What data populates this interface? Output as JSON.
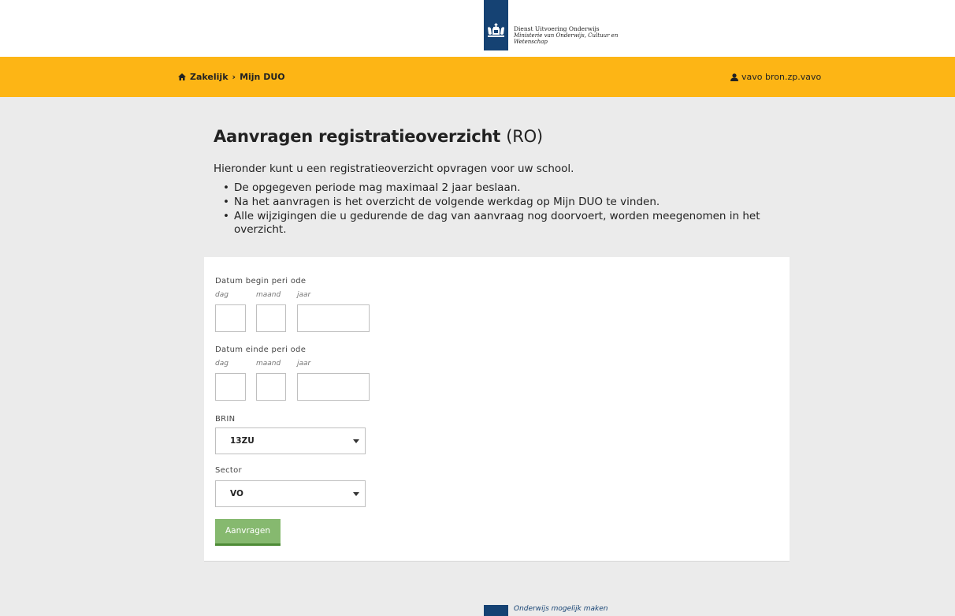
{
  "header": {
    "org_name": "Dienst Uitvoering Onderwijs",
    "ministry_line1": "Ministerie van Onderwijs, Cultuur en",
    "ministry_line2": "Wetenschap",
    "brand_color": "#154273"
  },
  "nav": {
    "home_icon": "home-icon",
    "crumb_1": "Zakelijk",
    "separator": "›",
    "crumb_2": "Mijn DUO",
    "user_icon": "user-icon",
    "user_name": "vavo bron.zp.vavo",
    "bar_color": "#fdb515"
  },
  "page": {
    "title": "Aanvragen registratieoverzicht",
    "title_suffix": "(RO)",
    "intro": "Hieronder kunt u een registratieoverzicht opvragen voor uw school.",
    "bullets": [
      "De opgegeven periode mag maximaal 2 jaar beslaan.",
      "Na het aanvragen is het overzicht de volgende werkdag op Mijn DUO te vinden.",
      "Alle wijzigingen die u gedurende de dag van aanvraag nog doorvoert, worden meegenomen in het overzicht."
    ]
  },
  "form": {
    "begin_label": "Datum begin peri ode",
    "end_label": "Datum einde peri ode",
    "day_label": "dag",
    "month_label": "maand",
    "year_label": "jaar",
    "begin_day": "",
    "begin_month": "",
    "begin_year": "",
    "end_day": "",
    "end_month": "",
    "end_year": "",
    "brin_label": "BRIN",
    "brin_value": "13ZU",
    "sector_label": "Sector",
    "sector_value": "VO",
    "submit_label": "Aanvragen",
    "submit_color": "#86b96f"
  },
  "footer": {
    "slogan": "Onderwijs mogelijk maken"
  }
}
